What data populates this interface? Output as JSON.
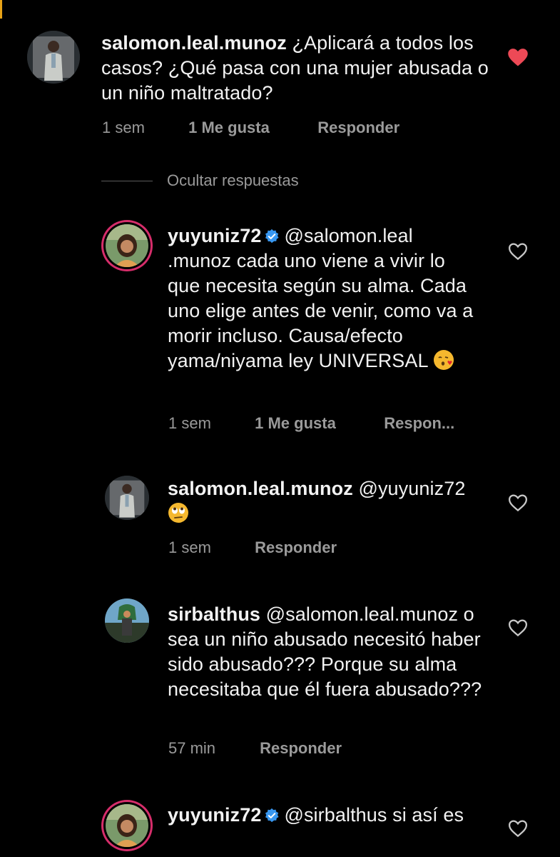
{
  "comments": [
    {
      "username": "salomon.leal.munoz",
      "text": "¿Aplicará a todos los casos? ¿Qué pasa con una mujer abusada o un niño maltratado?",
      "time": "1 sem",
      "likes": "1 Me gusta",
      "reply": "Responder",
      "liked": true,
      "avatar_icon": "man-in-suit-avatar"
    }
  ],
  "hide_replies_label": "Ocultar respuestas",
  "replies": [
    {
      "username": "yuyuniz72",
      "verified": true,
      "text": "@salomon.leal .munoz cada uno viene a vivir lo que necesita según su alma. Cada uno elige antes de venir, como va a morir incluso. Causa/efecto yama/niyama ley UNIVERSAL",
      "emoji": "face-blowing-kiss",
      "time": "1 sem",
      "likes": "1 Me gusta",
      "reply": "Respon...",
      "avatar_icon": "woman-story-ring-avatar"
    },
    {
      "username": "salomon.leal.munoz",
      "text": "@yuyuniz72",
      "emoji": "face-with-rolling-eyes",
      "time": "1 sem",
      "reply": "Responder",
      "avatar_icon": "man-in-suit-avatar"
    },
    {
      "username": "sirbalthus",
      "text": "@salomon.leal.munoz o sea un niño abusado necesitó haber sido abusado??? Porque su alma necesitaba que él fuera abusado???",
      "time": "57 min",
      "reply": "Responder",
      "avatar_icon": "landscape-avatar"
    },
    {
      "username": "yuyuniz72",
      "verified": true,
      "text": "@sirbalthus si así es",
      "avatar_icon": "woman-story-ring-avatar"
    }
  ],
  "colors": {
    "background": "#000000",
    "text": "#f2f2f2",
    "muted": "#9a9a9a",
    "heart_liked": "#ed4956",
    "verified": "#3897f0",
    "story_ring": "#d62d6a"
  }
}
